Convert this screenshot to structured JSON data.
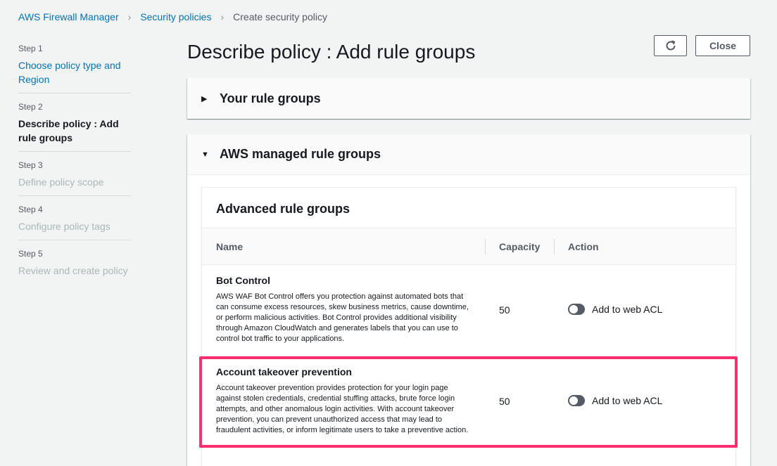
{
  "breadcrumb": {
    "items": [
      "AWS Firewall Manager",
      "Security policies"
    ],
    "current": "Create security policy"
  },
  "steps": [
    {
      "num": "Step 1",
      "label": "Choose policy type and Region",
      "state": "link"
    },
    {
      "num": "Step 2",
      "label": "Describe policy : Add rule groups",
      "state": "active"
    },
    {
      "num": "Step 3",
      "label": "Define policy scope",
      "state": "disabled"
    },
    {
      "num": "Step 4",
      "label": "Configure policy tags",
      "state": "disabled"
    },
    {
      "num": "Step 5",
      "label": "Review and create policy",
      "state": "disabled"
    }
  ],
  "page": {
    "title": "Describe policy : Add rule groups",
    "refresh_icon": "refresh-icon",
    "close_label": "Close"
  },
  "your_rule_groups": {
    "title": "Your rule groups",
    "expanded": false
  },
  "managed": {
    "title": "AWS managed rule groups",
    "expanded": true,
    "advanced": {
      "title": "Advanced rule groups",
      "columns": {
        "name": "Name",
        "capacity": "Capacity",
        "action": "Action"
      },
      "rows": [
        {
          "name": "Bot Control",
          "description": "AWS WAF Bot Control offers you protection against automated bots that can consume excess resources, skew business metrics, cause downtime, or perform malicious activities. Bot Control provides additional visibility through Amazon CloudWatch and generates labels that you can use to control bot traffic to your applications.",
          "capacity": "50",
          "action": "Add to web ACL",
          "enabled": false
        },
        {
          "name": "Account takeover prevention",
          "description": "Account takeover prevention provides protection for your login page against stolen credentials, credential stuffing attacks, brute force login attempts, and other anomalous login activities. With account takeover prevention, you can prevent unauthorized access that may lead to fraudulent activities, or inform legitimate users to take a preventive action.",
          "capacity": "50",
          "action": "Add to web ACL",
          "enabled": false
        }
      ]
    }
  },
  "colors": {
    "accent": "#0073bb",
    "highlight": "#ff2d6f"
  }
}
